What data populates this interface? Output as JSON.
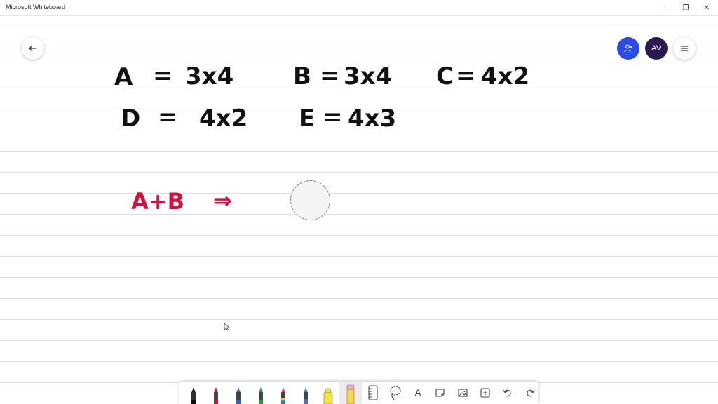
{
  "window": {
    "title": "Microsoft Whiteboard",
    "minimize_glyph": "–",
    "restore_glyph": "❐",
    "close_glyph": "✕"
  },
  "header": {
    "back_icon": "arrow-left-icon",
    "share_icon": "person-add-icon",
    "avatar_initials": "AV",
    "menu_icon": "hamburger-menu-icon",
    "share_color": "#2a4bea",
    "avatar_color": "#2b1a52"
  },
  "board": {
    "lines": [
      {
        "id": "line-1",
        "text": "A = 3x4     B = 3x4     C = 4x2",
        "color": "#111111"
      },
      {
        "id": "line-2",
        "text": "D = 4x2     E = 4x3",
        "color": "#111111"
      },
      {
        "id": "line-3",
        "text": "A+B  ⇒",
        "color": "#d4103f"
      }
    ],
    "ink_terms": {
      "A1": "A",
      "eq1": "=",
      "A_dim": "3x4",
      "B1": "B",
      "eq2": "=",
      "B_dim": "3x4",
      "C1": "C",
      "eq3": "=",
      "C_dim": "4x2",
      "D1": "D",
      "eq4": "=",
      "D_dim": "4x2",
      "E1": "E",
      "eq5": "=",
      "E_dim": "4x3",
      "sum": "A+B",
      "arrow": "⇒"
    }
  },
  "toolbar": {
    "tools": [
      {
        "name": "pen-black",
        "color": "#111111"
      },
      {
        "name": "pen-red",
        "color": "#c2182b"
      },
      {
        "name": "pen-blue",
        "color": "#2b62c9"
      },
      {
        "name": "pen-green",
        "color": "#1f9a4a"
      },
      {
        "name": "pen-rainbow",
        "color": "#e0457b"
      },
      {
        "name": "pen-galaxy",
        "color": "#3a8fb7"
      },
      {
        "name": "highlighter",
        "color": "#f5e23a"
      },
      {
        "name": "eraser",
        "color": "#f0a8c8"
      },
      {
        "name": "ruler",
        "icon": "ruler-icon"
      },
      {
        "name": "lasso",
        "icon": "lasso-icon"
      },
      {
        "name": "text",
        "icon": "text-icon",
        "glyph": "A"
      },
      {
        "name": "sticky-note",
        "icon": "note-icon"
      },
      {
        "name": "image",
        "icon": "image-icon"
      },
      {
        "name": "add",
        "icon": "add-icon"
      },
      {
        "name": "undo",
        "icon": "undo-icon"
      },
      {
        "name": "redo",
        "icon": "redo-icon"
      }
    ]
  }
}
